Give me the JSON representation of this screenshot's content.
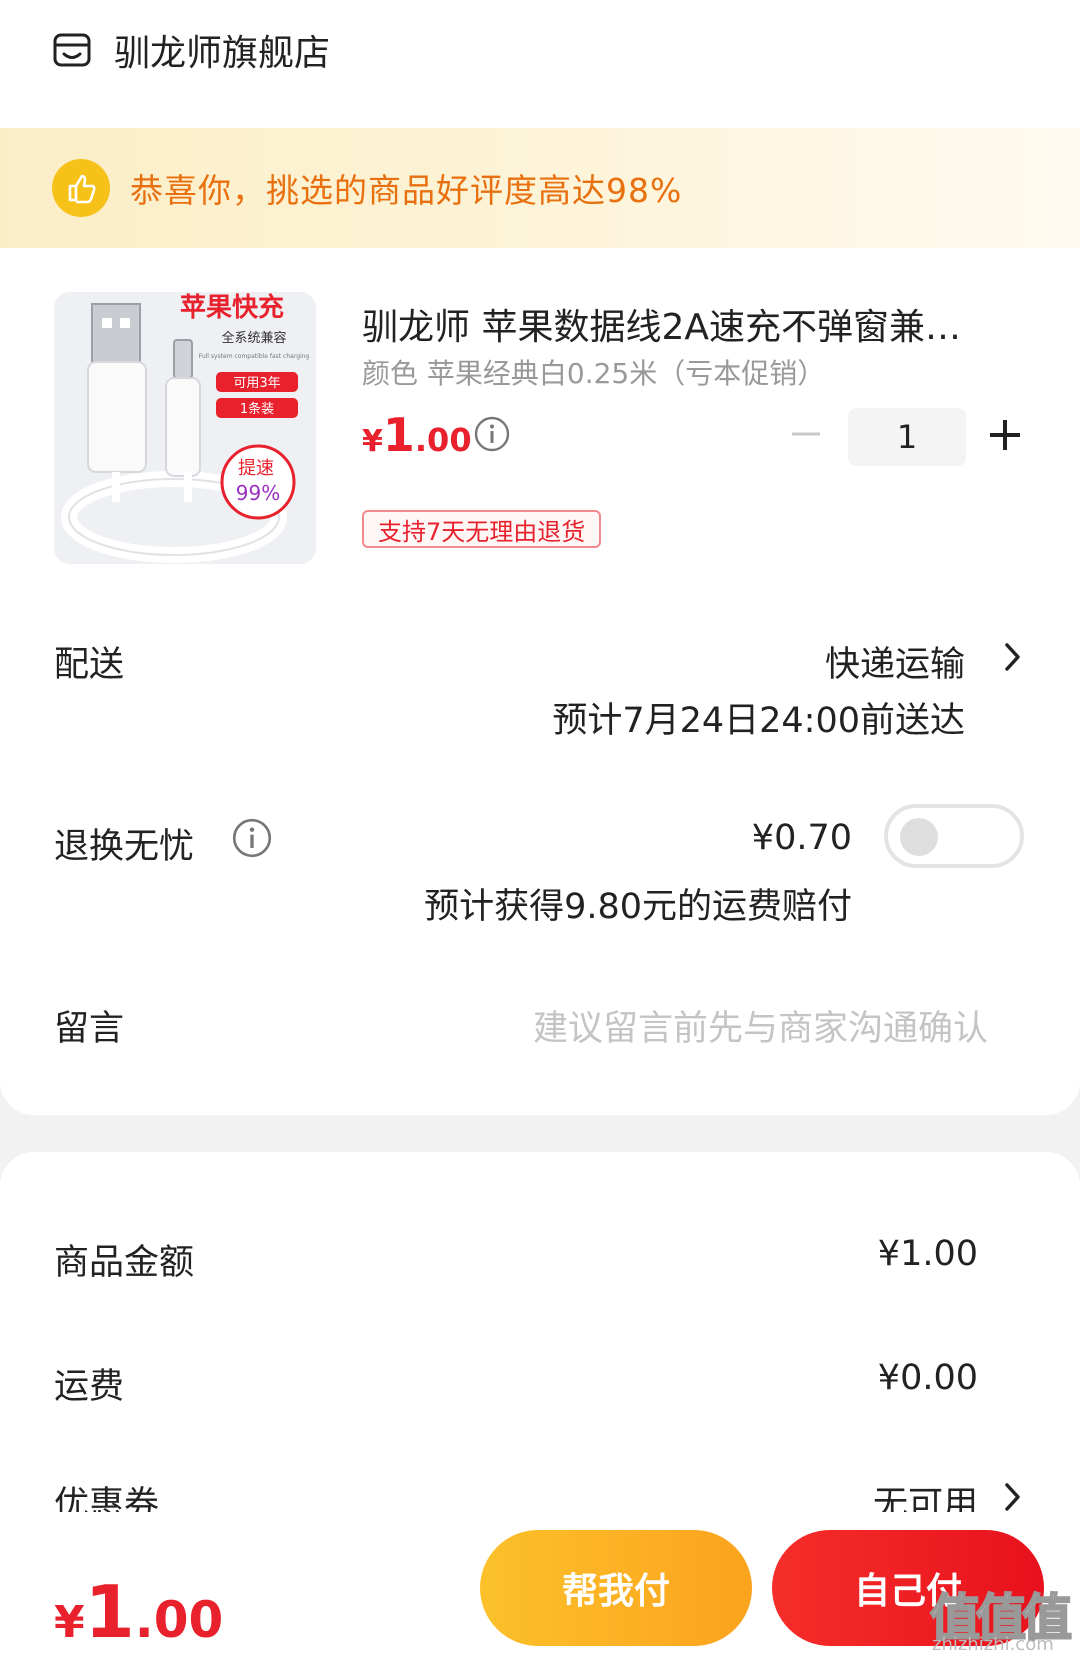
{
  "shop": {
    "name": "驯龙师旗舰店"
  },
  "banner": {
    "text": "恭喜你，挑选的商品好评度高达98%"
  },
  "product": {
    "image_texts": {
      "headline": "苹果快充",
      "line1": "全系统兼容",
      "line2": "Full system compatible fast charging",
      "badge1": "可用3年",
      "badge2": "1条装",
      "badge3": "提速",
      "badge4": "99%"
    },
    "title": "驯龙师 苹果数据线2A速充不弹窗兼…",
    "spec": "颜色 苹果经典白0.25米（亏本促销）",
    "price_currency": "¥",
    "price_int": "1",
    "price_dec": ".00",
    "quantity": "1",
    "return_tag": "支持7天无理由退货"
  },
  "delivery": {
    "label": "配送",
    "method": "快递运输",
    "eta": "预计7月24日24:00前送达"
  },
  "exchange": {
    "label": "退换无忧",
    "price": "¥0.70",
    "note": "预计获得9.80元的运费赔付",
    "enabled": false
  },
  "message": {
    "label": "留言",
    "placeholder": "建议留言前先与商家沟通确认"
  },
  "summary": {
    "goods_label": "商品金额",
    "goods_value": "¥1.00",
    "shipping_label": "运费",
    "shipping_value": "¥0.00",
    "coupon_label": "优惠券",
    "coupon_value": "无可用"
  },
  "footer": {
    "total_currency": "¥",
    "total_int": "1",
    "total_dec": ".00",
    "help_pay": "帮我付",
    "self_pay": "自己付",
    "watermark": "值值值",
    "watermark_url": "zhizhizhi.com"
  },
  "colors": {
    "accent_red": "#e8212d",
    "banner_orange": "#e8700f",
    "help_button": "#fcc12a",
    "self_button": "#f52e2a"
  }
}
